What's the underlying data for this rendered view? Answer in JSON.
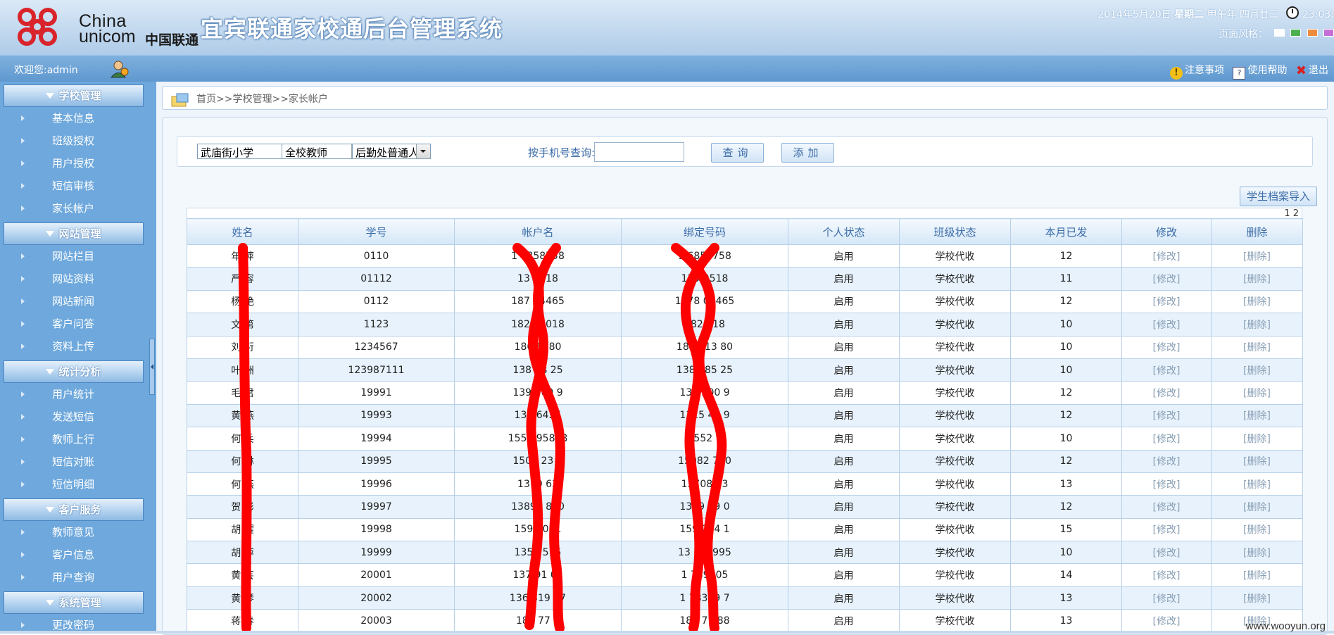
{
  "header": {
    "logo_en_line1": "China",
    "logo_en_line2": "unicom",
    "logo_cn": "中国联通",
    "title": "宜宾联通家校通后台管理系统",
    "date": "2014年5月20日",
    "weekday": "星期二",
    "meal": "甲午年",
    "lunar": "四月廿二",
    "time": "23:03:",
    "style_label": "页面风格：",
    "style_swatches": [
      "#ffffff",
      "#4caf50",
      "#f08a3c",
      "#c56fd6"
    ]
  },
  "topbar": {
    "welcome": "欢迎您:admin",
    "notice": "注意事项",
    "help": "使用帮助",
    "exit": "退出"
  },
  "sidebar": {
    "groups": [
      {
        "title": "学校管理",
        "items": [
          "基本信息",
          "班级授权",
          "用户授权",
          "短信审核",
          "家长帐户"
        ]
      },
      {
        "title": "网站管理",
        "items": [
          "网站栏目",
          "网站资料",
          "网站新闻",
          "客户问答",
          "资料上传"
        ]
      },
      {
        "title": "统计分析",
        "items": [
          "用户统计",
          "发送短信",
          "教师上行",
          "短信对账",
          "短信明细"
        ]
      },
      {
        "title": "客户服务",
        "items": [
          "教师意见",
          "客户信息",
          "用户查询"
        ]
      },
      {
        "title": "系统管理",
        "items": [
          "更改密码"
        ]
      }
    ]
  },
  "breadcrumb": "首页>>学校管理>>家长帐户",
  "filters": {
    "school": "武庙街小学",
    "teacher": "全校教师",
    "dept": "后勤处普通人",
    "search_label": "按手机号查询:",
    "search_value": "",
    "query_btn": "查询",
    "add_btn": "添加"
  },
  "import_btn": "学生档案导入",
  "pager": "1 2",
  "table": {
    "headers": [
      "姓名",
      "学号",
      "帐户名",
      "绑定号码",
      "个人状态",
      "班级状态",
      "本月已发",
      "修改",
      "删除"
    ],
    "rows": [
      [
        "年 萍",
        "0110",
        "1 6858758",
        "1 6858758",
        "启用",
        "学校代收",
        "12",
        "[修改]",
        "[删除]"
      ],
      [
        "严 容",
        "01112",
        "13 9518",
        "139 9518",
        "启用",
        "学校代收",
        "11",
        "[修改]",
        "[删除]"
      ],
      [
        "杨 艳",
        "0112",
        "187 04465",
        "1878 04465",
        "启用",
        "学校代收",
        "12",
        "[修改]",
        "[删除]"
      ],
      [
        "文 第",
        "1123",
        "182 62018",
        "182 018",
        "启用",
        "学校代收",
        "10",
        "[修改]",
        "[删除]"
      ],
      [
        "刘 衍",
        "1234567",
        "186 6880",
        "1866 13 80",
        "启用",
        "学校代收",
        "10",
        "[修改]",
        "[删除]"
      ],
      [
        "叶 洲",
        "123987111",
        "138 28 25",
        "138 285 25",
        "启用",
        "学校代收",
        "10",
        "[修改]",
        "[删除]"
      ],
      [
        "毛 君",
        "19991",
        "139 200 9",
        "139 200 9",
        "启用",
        "学校代收",
        "12",
        "[修改]",
        "[删除]"
      ],
      [
        "黄 燕",
        "19993",
        "131 6455",
        "1315 45 9",
        "启用",
        "学校代收",
        "12",
        "[修改]",
        "[删除]"
      ],
      [
        "何 兵",
        "19994",
        "1552 95898",
        "1552 7",
        "启用",
        "学校代收",
        "10",
        "[修改]",
        "[删除]"
      ],
      [
        "何 琳",
        "19995",
        "1508 23 0",
        "15082 710",
        "启用",
        "学校代收",
        "12",
        "[修改]",
        "[删除]"
      ],
      [
        "何 燕",
        "19996",
        "1370 63",
        "13708 63",
        "启用",
        "学校代收",
        "13",
        "[修改]",
        "[删除]"
      ],
      [
        "贺 彬",
        "19997",
        "13890 820",
        "1389 29 0",
        "启用",
        "学校代收",
        "12",
        "[修改]",
        "[删除]"
      ],
      [
        "胡 耀",
        "19998",
        "1590 081",
        "159 294 1",
        "启用",
        "学校代收",
        "15",
        "[修改]",
        "[删除]"
      ],
      [
        "胡 萍",
        "19999",
        "1350 515",
        "13 081995",
        "启用",
        "学校代收",
        "10",
        "[修改]",
        "[删除]"
      ],
      [
        "黄 芸",
        "20001",
        "137 91 63",
        "1 789105",
        "启用",
        "学校代收",
        "14",
        "[修改]",
        "[删除]"
      ],
      [
        "黄 琴",
        "20002",
        "136 319 37",
        "1 78319 7",
        "启用",
        "学校代收",
        "13",
        "[修改]",
        "[删除]"
      ],
      [
        "蒋 春",
        "20003",
        "180 77 8",
        "180 77 88",
        "启用",
        "学校代收",
        "13",
        "[修改]",
        "[删除]"
      ]
    ]
  },
  "watermark": "www.wooyun.org",
  "colors": {
    "accent": "#3b6ca8",
    "sidebar_bg": "#6ea8dc",
    "scribble": "#ff0000"
  }
}
